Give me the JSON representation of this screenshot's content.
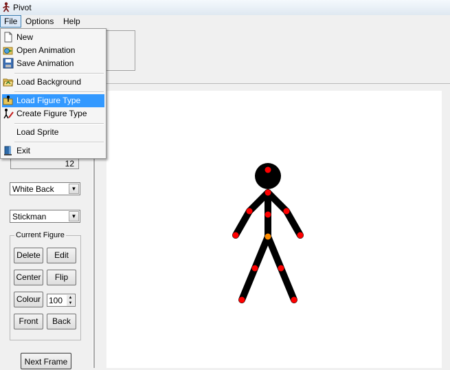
{
  "app": {
    "title": "Pivot"
  },
  "menubar": {
    "items": [
      "File",
      "Options",
      "Help"
    ]
  },
  "file_menu": {
    "items": [
      {
        "label": "New",
        "icon": "new-document-icon"
      },
      {
        "label": "Open Animation",
        "icon": "open-animation-icon"
      },
      {
        "label": "Save Animation",
        "icon": "save-icon"
      },
      {
        "label": "Load Background",
        "icon": "open-folder-icon"
      },
      {
        "label": "Load Figure Type",
        "icon": "load-figure-icon",
        "highlighted": true
      },
      {
        "label": "Create Figure Type",
        "icon": "create-figure-icon"
      },
      {
        "label": "Load Sprite",
        "icon": ""
      },
      {
        "label": "Exit",
        "icon": "exit-icon"
      }
    ]
  },
  "left_panel": {
    "speed_value": "12",
    "background_select": "White Back",
    "figure_select": "Stickman",
    "current_figure": {
      "legend": "Current Figure",
      "delete": "Delete",
      "edit": "Edit",
      "center": "Center",
      "flip": "Flip",
      "colour": "Colour",
      "opacity": "100",
      "front": "Front",
      "back": "Back"
    },
    "next_frame": "Next Frame"
  },
  "colors": {
    "figure": "#000000",
    "joint_handle": "#ff0000",
    "origin_handle": "#ff8c00",
    "canvas": "#ffffff",
    "menu_highlight": "#3399ff"
  }
}
